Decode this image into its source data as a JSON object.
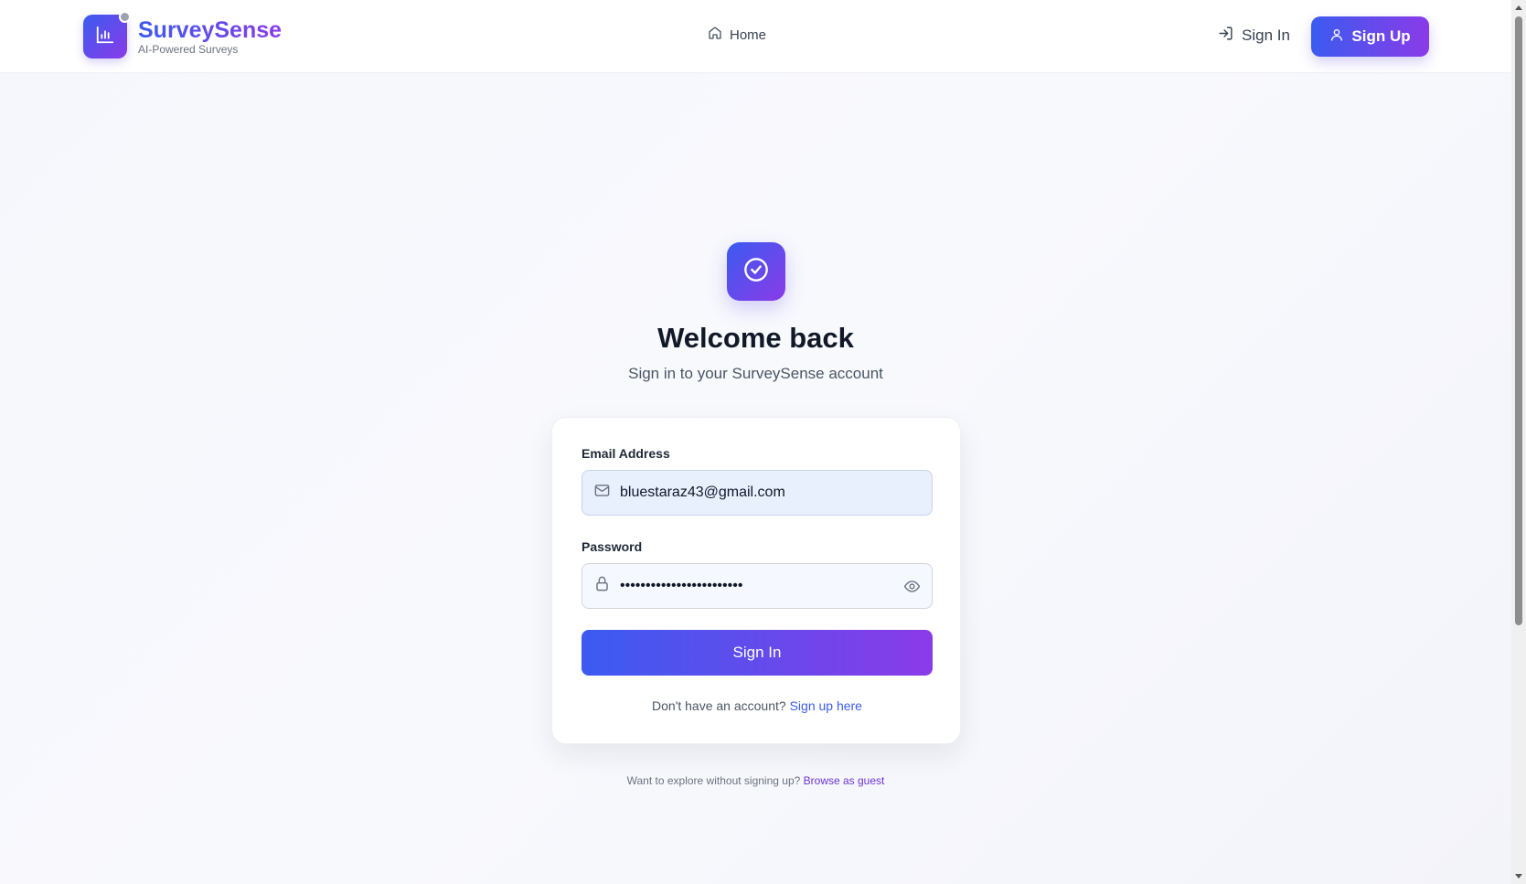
{
  "header": {
    "brand_name": "SurveySense",
    "brand_tagline": "AI-Powered Surveys",
    "nav_home": "Home",
    "signin_label": "Sign In",
    "signup_label": "Sign Up"
  },
  "hero": {
    "title": "Welcome back",
    "subtitle": "Sign in to your SurveySense account"
  },
  "form": {
    "email_label": "Email Address",
    "email_value": "bluestaraz43@gmail.com",
    "password_label": "Password",
    "password_value": "••••••••••••••••••••••••",
    "submit_label": "Sign In",
    "no_account_text": "Don't have an account?",
    "signup_link": "Sign up here"
  },
  "footer": {
    "guest_text": "Want to explore without signing up?",
    "guest_link": "Browse as guest"
  },
  "icons": {
    "logo": "bar-chart-icon",
    "home": "home-icon",
    "signin": "login-icon",
    "signup": "user-icon",
    "hero": "check-circle-icon",
    "email": "mail-icon",
    "password": "lock-icon",
    "toggle": "eye-icon"
  },
  "colors": {
    "accent_start": "#3b5bf0",
    "accent_end": "#8a3be8",
    "link": "#3b5bf0"
  }
}
